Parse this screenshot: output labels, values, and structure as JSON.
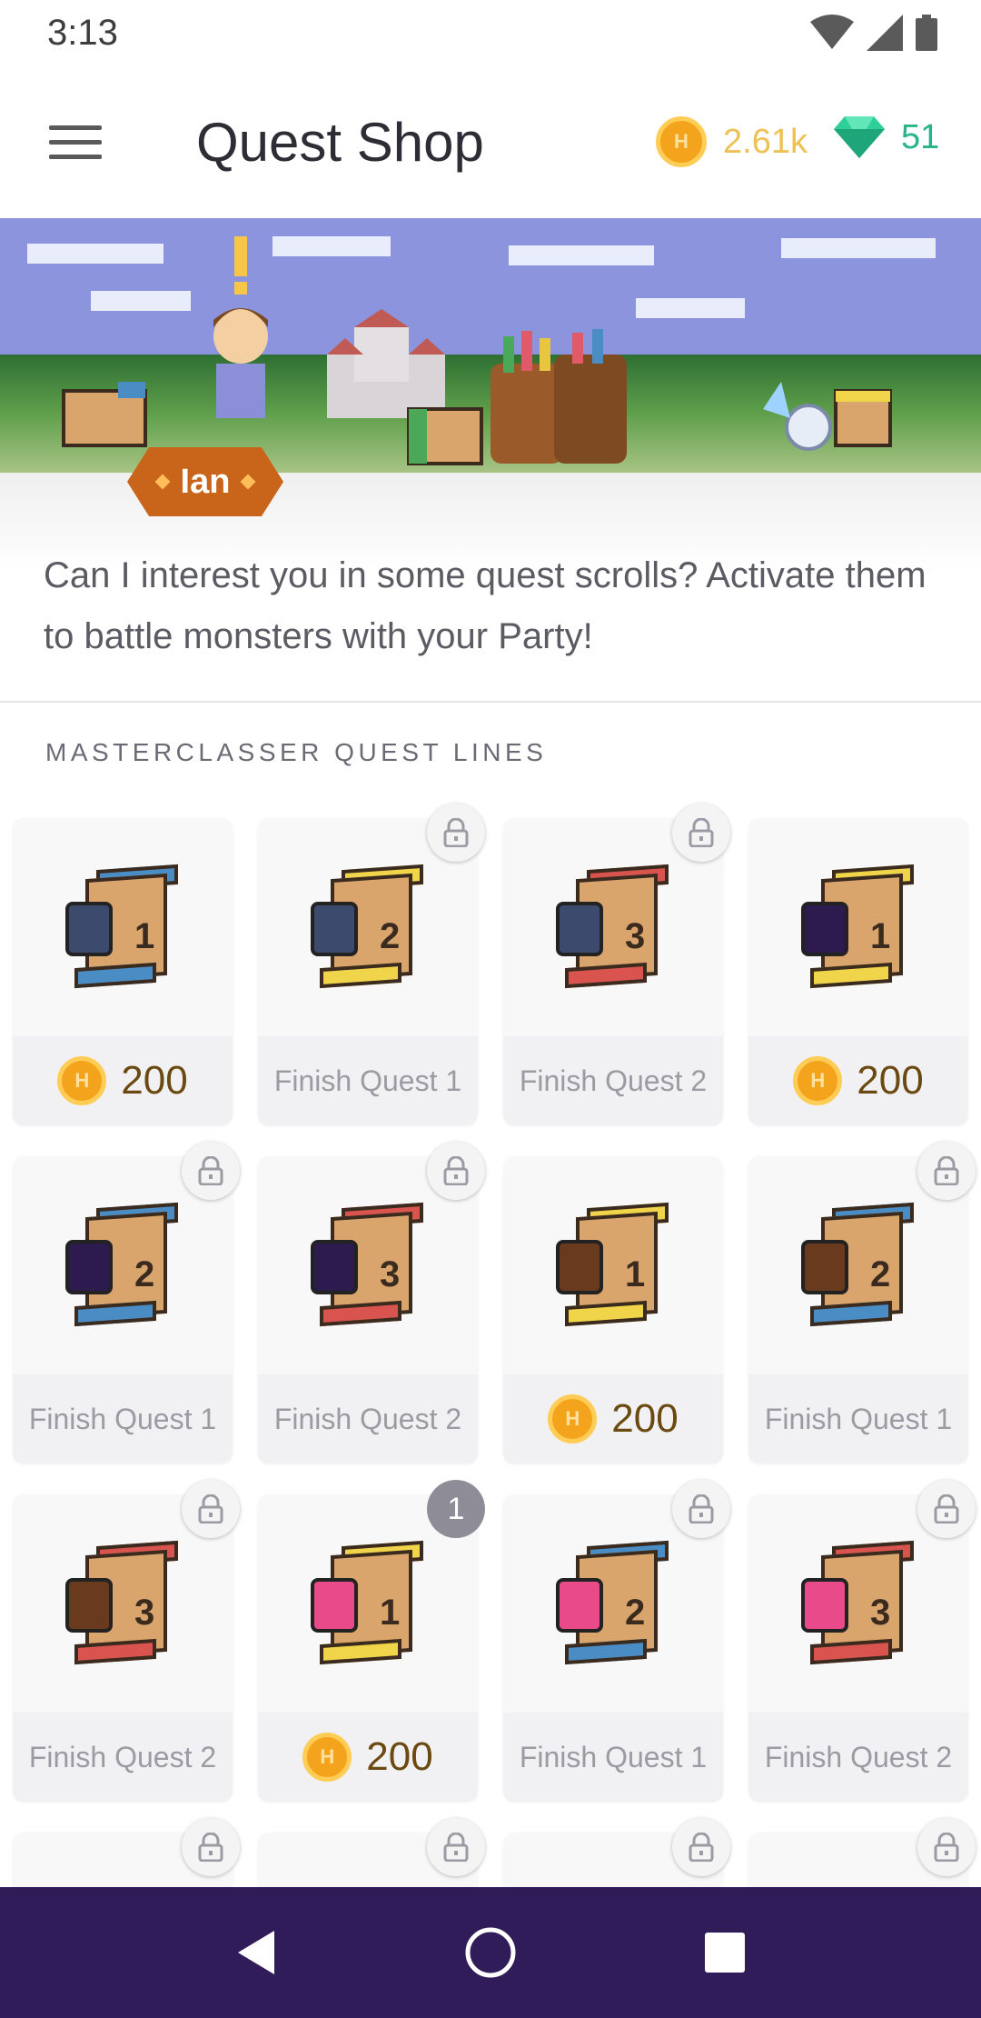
{
  "status_bar": {
    "time": "3:13"
  },
  "header": {
    "title": "Quest Shop",
    "gold": "2.61k",
    "gems": "51"
  },
  "banner": {
    "npc_name": "Ian",
    "intro": "Can I interest you in some quest scrolls? Activate them to battle monsters with your Party!"
  },
  "section": {
    "title": "MASTERCLASSER QUEST LINES"
  },
  "quests": [
    {
      "numeral": "1",
      "state": "price",
      "label": "200",
      "top_color": "#4a8cc4",
      "emblem": "mace"
    },
    {
      "numeral": "2",
      "state": "locked",
      "label": "Finish Quest 1",
      "top_color": "#f0d54a",
      "emblem": "mace"
    },
    {
      "numeral": "3",
      "state": "locked",
      "label": "Finish Quest 2",
      "top_color": "#d9534f",
      "emblem": "mace"
    },
    {
      "numeral": "1",
      "state": "price",
      "label": "200",
      "top_color": "#f0d54a",
      "emblem": "crystal"
    },
    {
      "numeral": "2",
      "state": "locked",
      "label": "Finish Quest 1",
      "top_color": "#4a8cc4",
      "emblem": "crystal"
    },
    {
      "numeral": "3",
      "state": "locked",
      "label": "Finish Quest 2",
      "top_color": "#d9534f",
      "emblem": "crystal"
    },
    {
      "numeral": "1",
      "state": "price",
      "label": "200",
      "top_color": "#f0d54a",
      "emblem": "staff"
    },
    {
      "numeral": "2",
      "state": "locked",
      "label": "Finish Quest 1",
      "top_color": "#4a8cc4",
      "emblem": "staff"
    },
    {
      "numeral": "3",
      "state": "locked",
      "label": "Finish Quest 2",
      "top_color": "#d9534f",
      "emblem": "staff"
    },
    {
      "numeral": "1",
      "state": "price",
      "label": "200",
      "top_color": "#f0d54a",
      "emblem": "prism",
      "badge": "1"
    },
    {
      "numeral": "2",
      "state": "locked",
      "label": "Finish Quest 1",
      "top_color": "#4a8cc4",
      "emblem": "prism"
    },
    {
      "numeral": "3",
      "state": "locked",
      "label": "Finish Quest 2",
      "top_color": "#d9534f",
      "emblem": "prism"
    }
  ],
  "colors": {
    "gold": "#efc155",
    "gems": "#26b58a",
    "nav_bar": "#2f1c58",
    "npc_tag": "#c9651a"
  }
}
